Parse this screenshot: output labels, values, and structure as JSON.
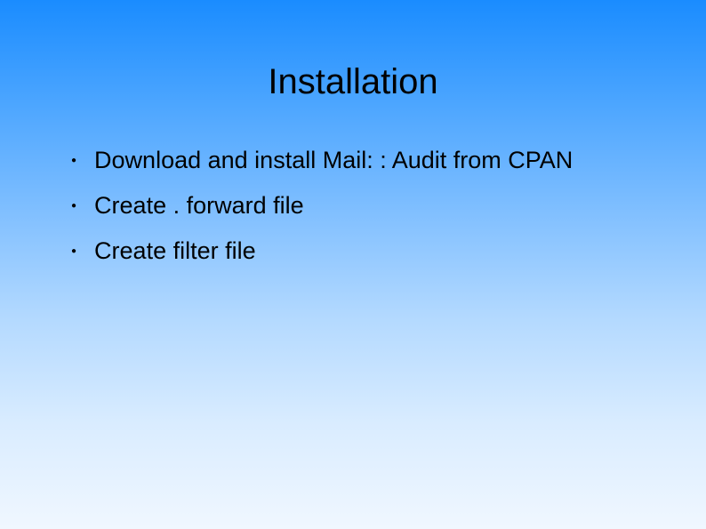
{
  "slide": {
    "title": "Installation",
    "bullets": [
      "Download and install Mail: : Audit from CPAN",
      "Create . forward file",
      "Create filter file"
    ]
  }
}
